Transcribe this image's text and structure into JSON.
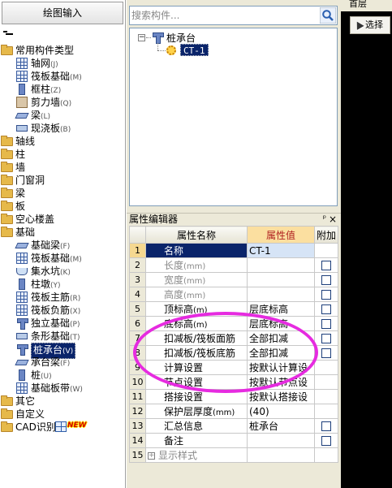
{
  "left_panel": {
    "title": "绘图输入",
    "tree": [
      {
        "label": "常用构件类型",
        "code": "",
        "type": "folder",
        "indent": 0
      },
      {
        "label": "轴网",
        "code": "(J)",
        "type": "grid",
        "indent": 1
      },
      {
        "label": "筏板基础",
        "code": "(M)",
        "type": "grid",
        "indent": 1
      },
      {
        "label": "框柱",
        "code": "(Z)",
        "type": "col",
        "indent": 1
      },
      {
        "label": "剪力墙",
        "code": "(Q)",
        "type": "wall",
        "indent": 1
      },
      {
        "label": "梁",
        "code": "(L)",
        "type": "beam",
        "indent": 1
      },
      {
        "label": "现浇板",
        "code": "(B)",
        "type": "slab",
        "indent": 1
      },
      {
        "label": "轴线",
        "code": "",
        "type": "folder",
        "indent": 0
      },
      {
        "label": "柱",
        "code": "",
        "type": "folder",
        "indent": 0
      },
      {
        "label": "墙",
        "code": "",
        "type": "folder",
        "indent": 0
      },
      {
        "label": "门窗洞",
        "code": "",
        "type": "folder",
        "indent": 0
      },
      {
        "label": "梁",
        "code": "",
        "type": "folder",
        "indent": 0
      },
      {
        "label": "板",
        "code": "",
        "type": "folder",
        "indent": 0
      },
      {
        "label": "空心楼盖",
        "code": "",
        "type": "folder",
        "indent": 0
      },
      {
        "label": "基础",
        "code": "",
        "type": "folder",
        "indent": 0
      },
      {
        "label": "基础梁",
        "code": "(F)",
        "type": "beam",
        "indent": 1
      },
      {
        "label": "筏板基础",
        "code": "(M)",
        "type": "grid",
        "indent": 1
      },
      {
        "label": "集水坑",
        "code": "(K)",
        "type": "pit",
        "indent": 1
      },
      {
        "label": "柱墩",
        "code": "(Y)",
        "type": "col",
        "indent": 1
      },
      {
        "label": "筏板主筋",
        "code": "(R)",
        "type": "grid",
        "indent": 1
      },
      {
        "label": "筏板负筋",
        "code": "(X)",
        "type": "grid",
        "indent": 1
      },
      {
        "label": "独立基础",
        "code": "(P)",
        "type": "pile",
        "indent": 1
      },
      {
        "label": "条形基础",
        "code": "(T)",
        "type": "slab",
        "indent": 1
      },
      {
        "label": "桩承台",
        "code": "(V)",
        "type": "pile",
        "indent": 1,
        "selected": true
      },
      {
        "label": "承台梁",
        "code": "(F)",
        "type": "beam",
        "indent": 1
      },
      {
        "label": "桩",
        "code": "(U)",
        "type": "col",
        "indent": 1
      },
      {
        "label": "基础板带",
        "code": "(W)",
        "type": "grid",
        "indent": 1
      },
      {
        "label": "其它",
        "code": "",
        "type": "folder",
        "indent": 0
      },
      {
        "label": "自定义",
        "code": "",
        "type": "folder",
        "indent": 0
      },
      {
        "label": "CAD识别",
        "code": "",
        "type": "folder",
        "indent": 0,
        "badge": "NEW"
      }
    ]
  },
  "search": {
    "placeholder": "搜索构件..."
  },
  "component_tree": {
    "root": "桩承台",
    "child": "CT-1"
  },
  "property_editor": {
    "title": "属性编辑器",
    "pin_glyph": "ᵖ",
    "close_glyph": "×",
    "columns": [
      "属性名称",
      "属性值",
      "附加"
    ],
    "rows": [
      {
        "num": "1",
        "name": "名称",
        "unit": "",
        "value": "CT-1",
        "checkbox": false,
        "gray": false,
        "highlight": true
      },
      {
        "num": "2",
        "name": "长度",
        "unit": "(mm)",
        "value": "",
        "checkbox": true,
        "gray": true
      },
      {
        "num": "3",
        "name": "宽度",
        "unit": "(mm)",
        "value": "",
        "checkbox": true,
        "gray": true
      },
      {
        "num": "4",
        "name": "高度",
        "unit": "(mm)",
        "value": "",
        "checkbox": true,
        "gray": true
      },
      {
        "num": "5",
        "name": "顶标高",
        "unit": "(m)",
        "value": "层底标高",
        "checkbox": true,
        "gray": false
      },
      {
        "num": "6",
        "name": "底标高",
        "unit": "(m)",
        "value": "层底标高",
        "checkbox": true,
        "gray": false
      },
      {
        "num": "7",
        "name": "扣减板/筏板面筋",
        "unit": "",
        "value": "全部扣减",
        "checkbox": true,
        "gray": false
      },
      {
        "num": "8",
        "name": "扣减板/筏板底筋",
        "unit": "",
        "value": "全部扣减",
        "checkbox": true,
        "gray": false
      },
      {
        "num": "9",
        "name": "计算设置",
        "unit": "",
        "value": "按默认计算设",
        "checkbox": false,
        "gray": false
      },
      {
        "num": "10",
        "name": "节点设置",
        "unit": "",
        "value": "按默认节点设",
        "checkbox": false,
        "gray": false
      },
      {
        "num": "11",
        "name": "搭接设置",
        "unit": "",
        "value": "按默认搭接设",
        "checkbox": false,
        "gray": false
      },
      {
        "num": "12",
        "name": "保护层厚度",
        "unit": "(mm)",
        "value": "(40)",
        "checkbox": false,
        "gray": false
      },
      {
        "num": "13",
        "name": "汇总信息",
        "unit": "",
        "value": "桩承台",
        "checkbox": true,
        "gray": false
      },
      {
        "num": "14",
        "name": "备注",
        "unit": "",
        "value": "",
        "checkbox": true,
        "gray": false
      },
      {
        "num": "15",
        "name": "显示样式",
        "unit": "",
        "value": "",
        "checkbox": false,
        "gray": true,
        "expander": "+"
      }
    ]
  },
  "right_panel": {
    "top_label": "首层",
    "select_label": "选择"
  },
  "colors": {
    "selection": "#0a246a",
    "annotation_ellipse": "#e62be0",
    "value_header": "#fbdfa0"
  }
}
